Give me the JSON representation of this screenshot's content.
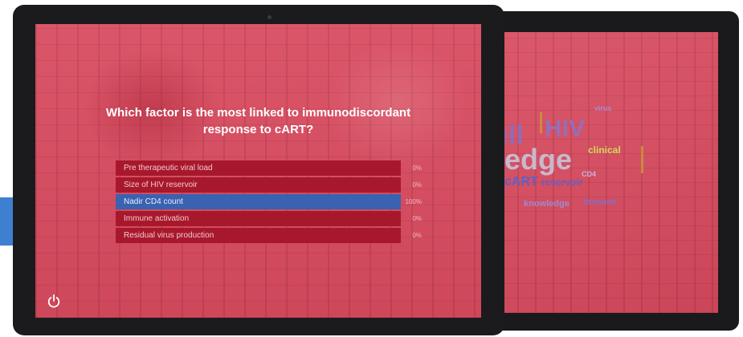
{
  "screen": {
    "question_line1": "Which factor is the most linked to immunodiscordant",
    "question_line2": "response to cART?",
    "options": [
      {
        "label": "Pre therapeutic viral load",
        "percent": "0%"
      },
      {
        "label": "Size of HIV reservoir",
        "percent": "0%"
      },
      {
        "label": "Nadir CD4 count",
        "percent": "100%",
        "selected": true
      },
      {
        "label": "Immune activation",
        "percent": "0%"
      },
      {
        "label": "Residual virus production",
        "percent": "0%"
      }
    ]
  },
  "word_cloud": {
    "words": [
      "ell",
      "HIV",
      "ledge",
      "clinical",
      "cART",
      "reservoir",
      "knowledge",
      "immune",
      "virus",
      "CD4"
    ]
  },
  "icons": {
    "power": "power-icon"
  },
  "colors": {
    "screen_tint": "#d94b5f",
    "option_bg": "#a8182c",
    "option_selected_bg": "#3a62b0",
    "accent_tab": "#3f7fd0"
  }
}
